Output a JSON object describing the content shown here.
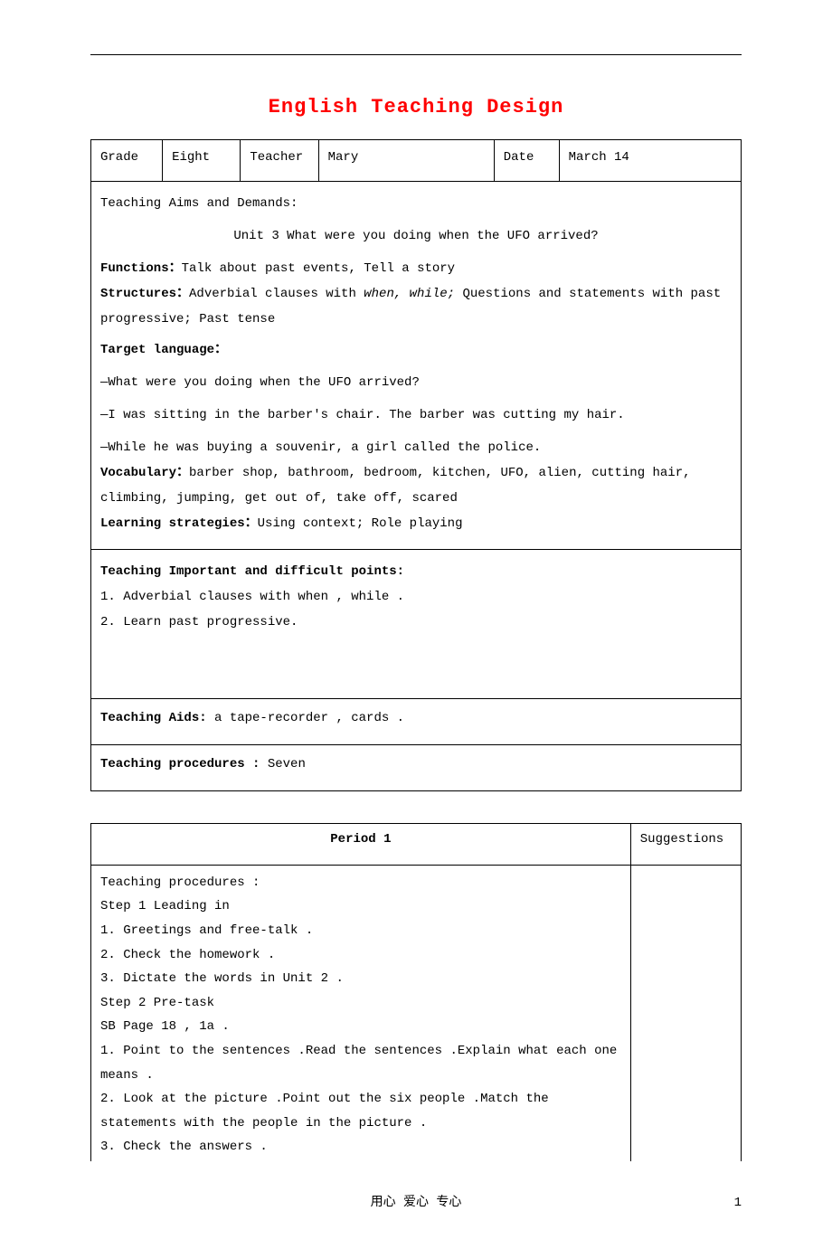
{
  "title": "English Teaching Design",
  "headerTable": {
    "gradeLabel": "Grade",
    "gradeValue": "Eight",
    "teacherLabel": "Teacher",
    "teacherValue": "Mary",
    "dateLabel": "Date",
    "dateValue": "March 14"
  },
  "aims": {
    "heading": "Teaching Aims and Demands:",
    "unit": "Unit 3 What were you doing when the UFO arrived?",
    "functionsLabel": "Functions：",
    "functionsText": "Talk about past events, Tell a story",
    "structuresLabel": "Structures：",
    "structuresTextPre": "Adverbial clauses with ",
    "structuresItalic": "when, while;",
    "structuresTextPost": " Questions and statements with past progressive; Past tense",
    "targetLabel": "Target language：",
    "target1": "—What were you doing when the UFO arrived?",
    "target2": "—I was sitting in the barber's chair. The barber was cutting my hair.",
    "target3": "—While he was buying a souvenir, a girl called the police.",
    "vocabLabel": "Vocabulary：",
    "vocabText": "barber shop, bathroom, bedroom, kitchen, UFO, alien, cutting hair, climbing, jumping, get out of, take off, scared",
    "strategiesLabel": "Learning strategies：",
    "strategiesText": "Using context; Role playing"
  },
  "important": {
    "heading": "Teaching Important and difficult points:",
    "p1": "1. Adverbial clauses with when , while .",
    "p2": "2. Learn past progressive."
  },
  "aids": {
    "label": "Teaching Aids:",
    "text": " a tape-recorder , cards ."
  },
  "procCount": {
    "label": "Teaching procedures :",
    "text": " Seven"
  },
  "period": {
    "title": "Period 1",
    "suggestions": "Suggestions",
    "procLabel": "Teaching procedures :",
    "step1": "Step 1  Leading in",
    "s1_1": "1. Greetings and free-talk .",
    "s1_2": "2. Check the homework .",
    "s1_3": "3. Dictate the words in Unit 2 .",
    "step2": "Step 2  Pre-task",
    "s2_sb": "SB Page 18 , 1a .",
    "s2_1": "1. Point to the sentences .Read the sentences .Explain what each one means .",
    "s2_2": "2. Look at the picture .Point out the six people .Match the statements with the people in the picture .",
    "s2_3": "3. Check the answers ."
  },
  "footer": {
    "text": "用心   爱心 专心",
    "page": "1"
  }
}
